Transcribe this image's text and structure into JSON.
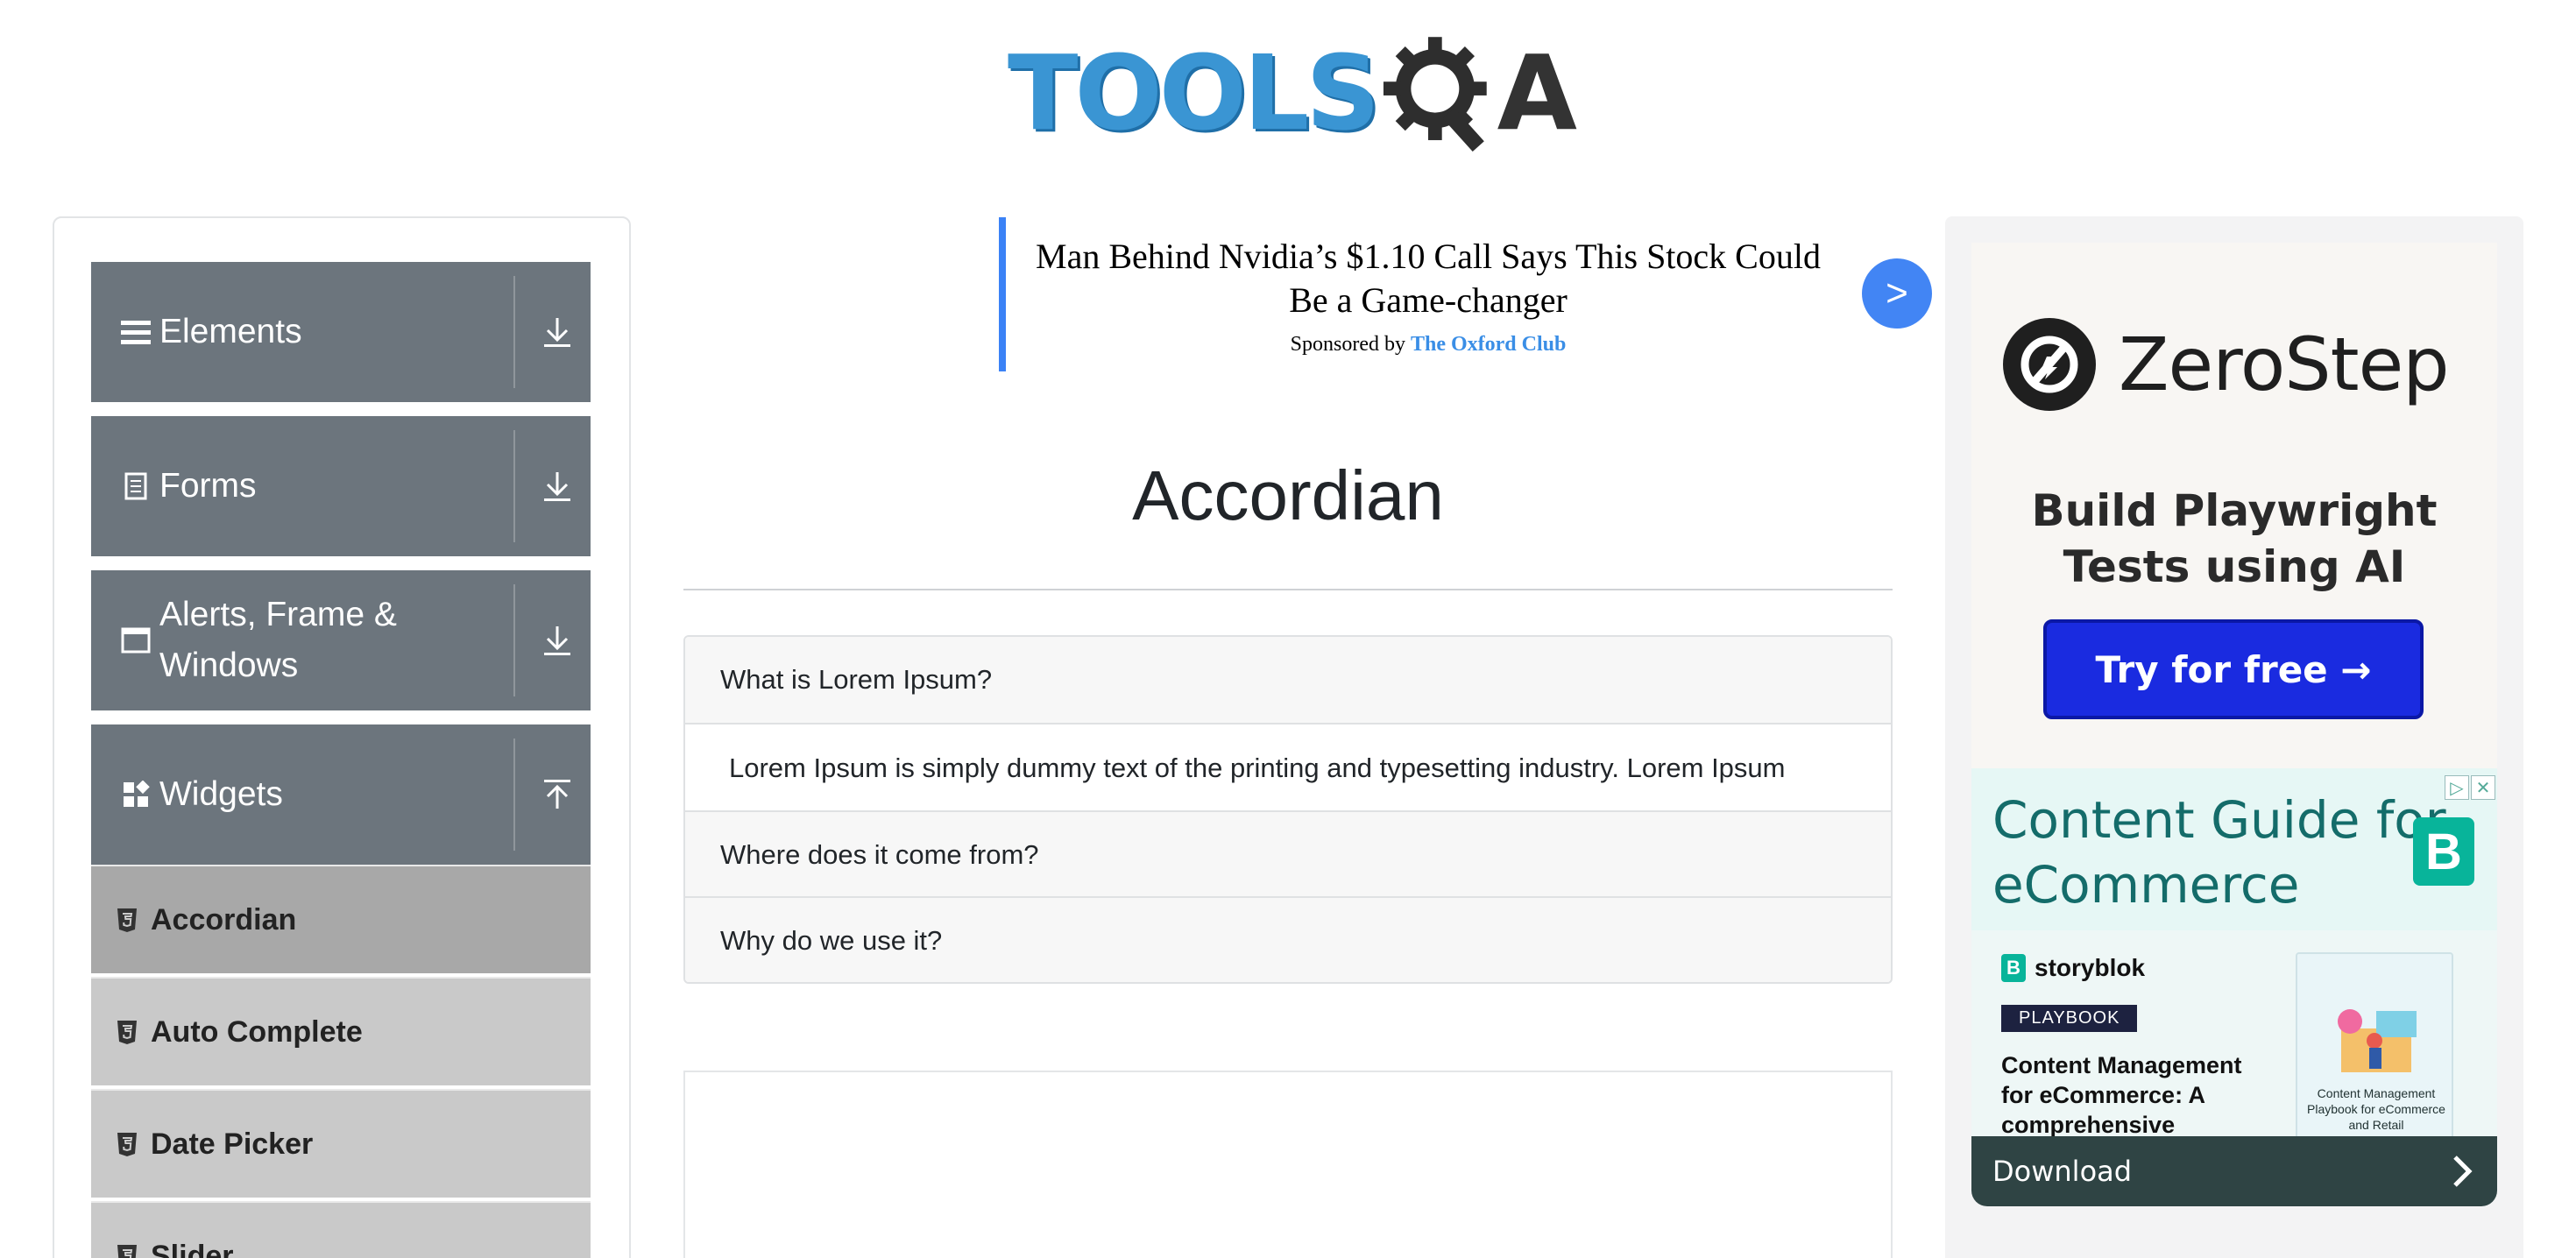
{
  "header": {
    "logo_alt": "TOOLSQA",
    "logo_text_left": "TOOLS",
    "logo_text_right": "A"
  },
  "sidebar": {
    "groups": [
      {
        "label": "Elements",
        "icon": "hamburger-icon",
        "state": "collapsed"
      },
      {
        "label": "Forms",
        "icon": "form-icon",
        "state": "collapsed"
      },
      {
        "label": "Alerts, Frame & Windows",
        "icon": "window-icon",
        "state": "collapsed"
      },
      {
        "label": "Widgets",
        "icon": "widgets-icon",
        "state": "expanded"
      }
    ],
    "widget_items": [
      {
        "label": "Accordian",
        "active": true
      },
      {
        "label": "Auto Complete",
        "active": false
      },
      {
        "label": "Date Picker",
        "active": false
      },
      {
        "label": "Slider",
        "active": false
      }
    ]
  },
  "center_ad": {
    "headline": "Man Behind Nvidia’s $1.10 Call Says This Stock Could Be a Game-changer",
    "sponsored_by": "Sponsored by",
    "sponsor": "The Oxford Club",
    "go_label": ">"
  },
  "main": {
    "title": "Accordian",
    "sections": [
      {
        "heading": "What is Lorem Ipsum?",
        "body": "Lorem Ipsum is simply dummy text of the printing and typesetting industry. Lorem Ipsum"
      },
      {
        "heading": "Where does it come from?"
      },
      {
        "heading": "Why do we use it?"
      }
    ]
  },
  "right_ad": {
    "zerostep": {
      "brand": "ZeroStep",
      "tagline": "Build Playwright Tests using AI",
      "cta": "Try for free →"
    },
    "storyblok": {
      "headline": "Content Guide for eCommerce",
      "brand": "storyblok",
      "pill": "PLAYBOOK",
      "title": "Content Management for eCommerce: A comprehensive marketer's guide",
      "book_text": "Content Management Playbook for eCommerce and Retail",
      "cta": "Download",
      "close_labels": [
        "▷",
        "✕"
      ]
    }
  },
  "colors": {
    "sidebar_header": "#6c757d",
    "sidebar_item": "#c9c9c9",
    "sidebar_active": "#a8a8a8",
    "ad_bar": "#3b82f6",
    "cta_blue": "#1a2be0",
    "storyblok_teal": "#146c6a"
  }
}
